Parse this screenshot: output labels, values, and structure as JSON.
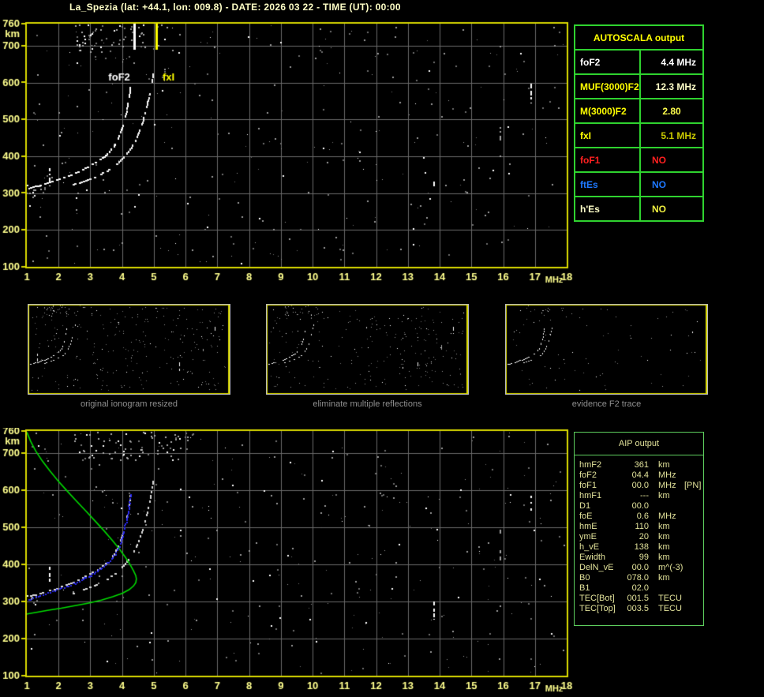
{
  "title": "La_Spezia (lat: +44.1, lon: 009.8) - DATE: 2026 03 22 - TIME (UT): 00:00",
  "colors": {
    "background": "#000000",
    "plot_border": "#d9d900",
    "grid": "#6b6b6b",
    "axis_text": "#ffff8e",
    "title_text": "#ffffc6",
    "noise_gray": "#9a9a9a",
    "fof2_marker": "#ffffff",
    "fxi_marker": "#ffff00",
    "profile_green": "#00dc00",
    "restored_blue": "#2b2bf2",
    "table_border_green": "#2fd32f",
    "aip_text": "#e2e29a",
    "caption_gray": "#8f8f8f"
  },
  "autoscala_table": {
    "title": "AUTOSCALA output",
    "rows": [
      {
        "label": "foF2",
        "value": "4.4 MHz",
        "label_color": "#ffffff",
        "value_color": "#ffffff",
        "align": "right"
      },
      {
        "label": "MUF(3000)F2",
        "value": "12.3 MHz",
        "label_color": "#ffff00",
        "value_color": "#ffffc8",
        "align": "right"
      },
      {
        "label": "M(3000)F2",
        "value": "2.80",
        "label_color": "#ffff00",
        "value_color": "#ffff4d",
        "align": "center"
      },
      {
        "label": "fxI",
        "value": "5.1 MHz",
        "label_color": "#ffff00",
        "value_color": "#c9c900",
        "align": "right"
      },
      {
        "label": "foF1",
        "value": "NO",
        "label_color": "#ff2020",
        "value_color": "#ff2020",
        "align": "left"
      },
      {
        "label": "ftEs",
        "value": "NO",
        "label_color": "#1e78ff",
        "value_color": "#1e78ff",
        "align": "left"
      },
      {
        "label": "h'Es",
        "value": "NO",
        "label_color": "#ffffc8",
        "value_color": "#f0f040",
        "align": "left"
      }
    ]
  },
  "aip_table": {
    "title": "AIP output",
    "rows": [
      {
        "label": "hmF2",
        "value": "361",
        "unit": "km",
        "extra": ""
      },
      {
        "label": "foF2",
        "value": "04.4",
        "unit": "MHz",
        "extra": ""
      },
      {
        "label": "foF1",
        "value": "00.0",
        "unit": "MHz",
        "extra": "[PN]"
      },
      {
        "label": "hmF1",
        "value": "---",
        "unit": "km",
        "extra": ""
      },
      {
        "label": "D1",
        "value": "00.0",
        "unit": "",
        "extra": ""
      },
      {
        "label": "foE",
        "value": "0.6",
        "unit": "MHz",
        "extra": ""
      },
      {
        "label": "hmE",
        "value": "110",
        "unit": "km",
        "extra": ""
      },
      {
        "label": "ymE",
        "value": "20",
        "unit": "km",
        "extra": ""
      },
      {
        "label": "h_vE",
        "value": "138",
        "unit": "km",
        "extra": ""
      },
      {
        "label": "Ewidth",
        "value": "99",
        "unit": "km",
        "extra": ""
      },
      {
        "label": "DelN_vE",
        "value": "00.0",
        "unit": "m^(-3)",
        "extra": ""
      },
      {
        "label": "B0",
        "value": "078.0",
        "unit": "km",
        "extra": ""
      },
      {
        "label": "B1",
        "value": "02.0",
        "unit": "",
        "extra": ""
      },
      {
        "label": "TEC[Bot]",
        "value": "001.5",
        "unit": "TECU",
        "extra": ""
      },
      {
        "label": "TEC[Top]",
        "value": "003.5",
        "unit": "TECU",
        "extra": ""
      }
    ]
  },
  "panels": [
    {
      "caption": "original ionogram resized"
    },
    {
      "caption": "eliminate multiple reflections"
    },
    {
      "caption": "evidence F2 trace"
    }
  ],
  "chart_data": {
    "type": "scatter",
    "title": "Ionogram with AUTOSCALA interpretation",
    "xlabel": "MHz",
    "ylabel": "km",
    "xlim": [
      1,
      18
    ],
    "ylim": [
      100,
      760
    ],
    "grid": true,
    "x_ticks": [
      1,
      2,
      3,
      4,
      5,
      6,
      7,
      8,
      9,
      10,
      11,
      12,
      13,
      14,
      15,
      16,
      17,
      18
    ],
    "y_ticks": [
      100,
      200,
      300,
      400,
      500,
      600,
      700,
      760
    ],
    "markers": [
      {
        "label": "foF2",
        "freq_mhz": 4.4
      },
      {
        "label": "fxI",
        "freq_mhz": 5.1
      }
    ],
    "o_trace": [
      [
        1.15,
        314
      ],
      [
        1.3,
        317
      ],
      [
        1.45,
        320
      ],
      [
        1.6,
        324
      ],
      [
        1.75,
        328
      ],
      [
        1.9,
        332
      ],
      [
        2.05,
        336
      ],
      [
        2.2,
        341
      ],
      [
        2.35,
        346
      ],
      [
        2.5,
        351
      ],
      [
        2.65,
        357
      ],
      [
        2.8,
        363
      ],
      [
        2.95,
        370
      ],
      [
        3.1,
        377
      ],
      [
        3.25,
        385
      ],
      [
        3.4,
        394
      ],
      [
        3.55,
        405
      ],
      [
        3.68,
        417
      ],
      [
        3.8,
        431
      ],
      [
        3.9,
        447
      ],
      [
        3.98,
        464
      ],
      [
        4.05,
        482
      ],
      [
        4.11,
        501
      ],
      [
        4.16,
        521
      ],
      [
        4.2,
        541
      ],
      [
        4.24,
        560
      ],
      [
        4.27,
        578
      ],
      [
        4.3,
        595
      ]
    ],
    "x_trace": [
      [
        2.35,
        318
      ],
      [
        2.55,
        323
      ],
      [
        2.75,
        329
      ],
      [
        2.95,
        335
      ],
      [
        3.15,
        342
      ],
      [
        3.35,
        350
      ],
      [
        3.55,
        359
      ],
      [
        3.75,
        370
      ],
      [
        3.92,
        382
      ],
      [
        4.08,
        396
      ],
      [
        4.22,
        411
      ],
      [
        4.35,
        428
      ],
      [
        4.47,
        447
      ],
      [
        4.57,
        468
      ],
      [
        4.66,
        491
      ],
      [
        4.74,
        515
      ],
      [
        4.81,
        539
      ],
      [
        4.87,
        562
      ],
      [
        4.92,
        584
      ],
      [
        4.97,
        606
      ],
      [
        5.01,
        628
      ]
    ],
    "restored_trace": [
      [
        1.0,
        301
      ],
      [
        1.15,
        306
      ],
      [
        1.3,
        311
      ],
      [
        1.45,
        315
      ],
      [
        1.6,
        319
      ],
      [
        1.75,
        323
      ],
      [
        1.9,
        327
      ],
      [
        2.05,
        331
      ],
      [
        2.2,
        336
      ],
      [
        2.35,
        341
      ],
      [
        2.5,
        346
      ],
      [
        2.65,
        352
      ],
      [
        2.8,
        358
      ],
      [
        2.95,
        365
      ],
      [
        3.1,
        372
      ],
      [
        3.25,
        380
      ],
      [
        3.4,
        390
      ],
      [
        3.55,
        401
      ],
      [
        3.68,
        413
      ],
      [
        3.8,
        427
      ],
      [
        3.9,
        443
      ],
      [
        3.98,
        460
      ],
      [
        4.05,
        478
      ],
      [
        4.11,
        497
      ],
      [
        4.16,
        517
      ],
      [
        4.2,
        537
      ],
      [
        4.24,
        556
      ],
      [
        4.27,
        574
      ],
      [
        4.31,
        586
      ],
      [
        4.34,
        593
      ]
    ],
    "density_profile": [
      [
        1.0,
        757
      ],
      [
        1.12,
        732
      ],
      [
        1.28,
        706
      ],
      [
        1.48,
        680
      ],
      [
        1.72,
        653
      ],
      [
        1.98,
        626
      ],
      [
        2.26,
        599
      ],
      [
        2.55,
        572
      ],
      [
        2.85,
        545
      ],
      [
        3.14,
        518
      ],
      [
        3.42,
        492
      ],
      [
        3.68,
        466
      ],
      [
        3.91,
        442
      ],
      [
        4.1,
        420
      ],
      [
        4.25,
        400
      ],
      [
        4.36,
        383
      ],
      [
        4.43,
        370
      ],
      [
        4.45,
        361
      ],
      [
        4.43,
        351
      ],
      [
        4.36,
        342
      ],
      [
        4.22,
        332
      ],
      [
        4.0,
        322
      ],
      [
        3.7,
        313
      ],
      [
        3.35,
        304
      ],
      [
        2.95,
        296
      ],
      [
        2.52,
        289
      ],
      [
        2.08,
        282
      ],
      [
        1.65,
        276
      ],
      [
        1.3,
        271
      ],
      [
        1.05,
        267
      ],
      [
        1.0,
        266
      ]
    ],
    "rfi_columns": [
      {
        "f": 1.72,
        "h1": 318,
        "h2": 392,
        "color": "#ffffff"
      },
      {
        "f": 13.82,
        "h1": 248,
        "h2": 330,
        "color": "#ffffff"
      },
      {
        "f": 15.9,
        "h1": 395,
        "h2": 492,
        "color": "#a0a0a0"
      },
      {
        "f": 16.88,
        "h1": 543,
        "h2": 597,
        "color": "#ffffff"
      }
    ],
    "second_hop_clusters": {
      "top": [
        {
          "f_min": 2.5,
          "f_max": 5.4,
          "h_min": 682,
          "h_max": 758,
          "count": 70
        },
        {
          "f_min": 1.0,
          "f_max": 1.6,
          "h_min": 298,
          "h_max": 322,
          "count": 12
        }
      ],
      "bottom": [
        {
          "f_min": 2.5,
          "f_max": 6.3,
          "h_min": 682,
          "h_max": 758,
          "count": 80
        },
        {
          "f_min": 1.0,
          "f_max": 1.5,
          "h_min": 290,
          "h_max": 318,
          "count": 10
        }
      ],
      "panel": [
        {
          "f_min": 2.5,
          "f_max": 5.4,
          "h_min": 680,
          "h_max": 758,
          "count": 26
        }
      ]
    },
    "autoscala_values": {
      "foF2_MHz": 4.4,
      "MUF3000F2_MHz": 12.3,
      "M3000F2": 2.8,
      "fxI_MHz": 5.1,
      "foF1": "NO",
      "ftEs": "NO",
      "hEs": "NO"
    },
    "aip_values": {
      "hmF2_km": 361,
      "foF2_MHz": 4.4,
      "foF1_MHz": 0.0,
      "hmF1_km": null,
      "D1": 0.0,
      "foE_MHz": 0.6,
      "hmE_km": 110,
      "ymE_km": 20,
      "h_vE_km": 138,
      "Ewidth_km": 99,
      "DelN_vE": 0.0,
      "B0_km": 78.0,
      "B1": 2.0,
      "TEC_Bot_TECU": 1.5,
      "TEC_Top_TECU": 3.5
    }
  }
}
